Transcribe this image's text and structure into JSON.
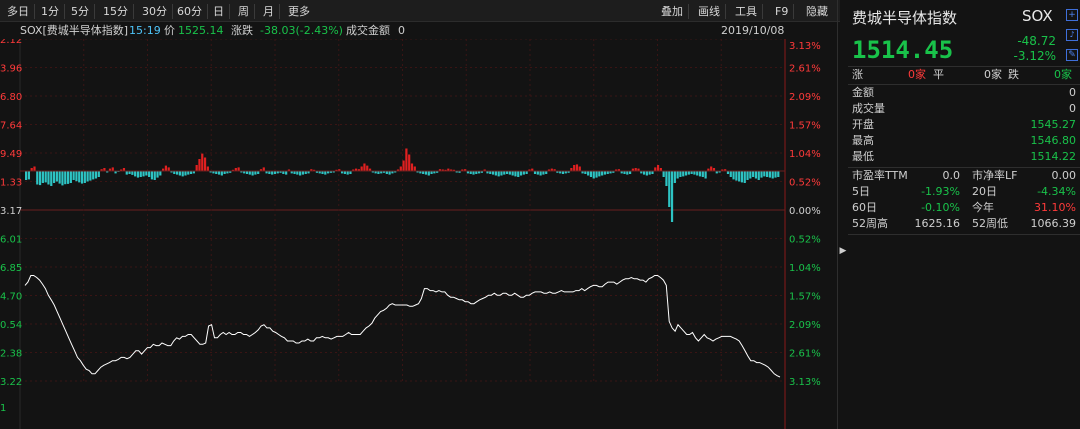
{
  "toolbar": {
    "periods": [
      "多日",
      "1分",
      "5分",
      "15分",
      "30分",
      "60分",
      "日",
      "周",
      "月",
      "更多"
    ],
    "tools": [
      "叠加",
      "画线",
      "工具",
      "F9",
      "隐藏"
    ]
  },
  "infobar": {
    "symbol": "SOX[费城半导体指数]",
    "time": "15:19",
    "price_label": "价",
    "price": "1525.14",
    "change_label": "涨跌",
    "change": "-38.03(-2.43%)",
    "volume_label": "成交金额",
    "volume": "0",
    "date": "2019/10/08"
  },
  "chart_data": {
    "type": "line",
    "title": "SOX[费城半导体指数]",
    "left_ticks": [
      "2.12",
      "3.96",
      "6.80",
      "7.64",
      "9.49",
      "1.33",
      "3.17",
      "6.01",
      "6.85",
      "4.70",
      "0.54",
      "2.38",
      "3.22",
      "1"
    ],
    "right_ticks": [
      "3.13%",
      "2.61%",
      "2.09%",
      "1.57%",
      "1.04%",
      "0.52%",
      "0.00%",
      "0.52%",
      "1.04%",
      "1.57%",
      "2.09%",
      "2.61%",
      "3.13%"
    ],
    "price_series": [
      -1.7,
      -1.65,
      -1.55,
      -1.55,
      -1.58,
      -1.62,
      -1.68,
      -1.75,
      -1.85,
      -1.92,
      -2.0,
      -2.1,
      -2.2,
      -2.3,
      -2.4,
      -2.5,
      -2.6,
      -2.7,
      -2.8,
      -2.85,
      -2.92,
      -2.98,
      -3.0,
      -3.05,
      -3.05,
      -3.0,
      -2.95,
      -2.92,
      -2.9,
      -2.88,
      -2.85,
      -2.85,
      -2.83,
      -2.8,
      -2.8,
      -2.82,
      -2.8,
      -2.75,
      -2.7,
      -2.7,
      -2.75,
      -2.7,
      -2.65,
      -2.65,
      -2.6,
      -2.62,
      -2.62,
      -2.58,
      -2.6,
      -2.62,
      -2.62,
      -2.55,
      -2.5,
      -2.52,
      -2.48,
      -2.48,
      -2.45,
      -2.45,
      -2.5,
      -2.55,
      -2.6,
      -2.6,
      -2.58,
      -2.32,
      -2.3,
      -2.5,
      -2.5,
      -2.45,
      -2.42,
      -2.45,
      -2.42,
      -2.45,
      -2.45,
      -2.42,
      -2.42,
      -2.45,
      -2.45,
      -2.48,
      -2.45,
      -2.42,
      -2.38,
      -2.32,
      -2.3,
      -2.35,
      -2.35,
      -2.4,
      -2.42,
      -2.45,
      -2.48,
      -2.5,
      -2.55,
      -2.55,
      -2.55,
      -2.58,
      -2.58,
      -2.55,
      -2.55,
      -2.52,
      -2.55,
      -2.55,
      -2.5,
      -2.5,
      -2.48,
      -2.5,
      -2.5,
      -2.52,
      -2.5,
      -2.48,
      -2.48,
      -2.48,
      -2.45,
      -2.42,
      -2.45,
      -2.45,
      -2.45,
      -2.45,
      -2.4,
      -2.35,
      -2.32,
      -2.28,
      -2.2,
      -2.15,
      -2.1,
      -2.08,
      -2.05,
      -2.0,
      -1.98,
      -2.0,
      -2.0,
      -2.0,
      -2.0,
      -2.0,
      -2.02,
      -2.02,
      -2.0,
      -1.98,
      -1.9,
      -1.75,
      -1.75,
      -1.78,
      -1.78,
      -1.8,
      -1.78,
      -1.8,
      -1.8,
      -1.85,
      -1.88,
      -1.88,
      -1.9,
      -1.92,
      -1.92,
      -1.95,
      -1.95,
      -1.98,
      -1.98,
      -1.95,
      -1.92,
      -1.9,
      -1.88,
      -1.85,
      -1.85,
      -1.82,
      -1.85,
      -1.85,
      -1.82,
      -1.82,
      -1.85,
      -1.85,
      -1.82,
      -1.85,
      -1.88,
      -1.88,
      -1.85,
      -1.85,
      -1.82,
      -1.8,
      -1.8,
      -1.8,
      -1.82,
      -1.82,
      -1.8,
      -1.82,
      -1.82,
      -1.8,
      -1.78,
      -1.8,
      -1.8,
      -1.8,
      -1.8,
      -1.78,
      -1.78,
      -1.75,
      -1.78,
      -1.75,
      -1.72,
      -1.7,
      -1.7,
      -1.72,
      -1.72,
      -1.68,
      -1.65,
      -1.65,
      -1.65,
      -1.68,
      -1.65,
      -1.62,
      -1.6,
      -1.6,
      -1.58,
      -1.6,
      -1.6,
      -1.62,
      -1.62,
      -1.65,
      -1.6,
      -1.58,
      -1.55,
      -1.55,
      -1.58,
      -1.62,
      -1.7,
      -2.25,
      -2.35,
      -2.4,
      -2.3,
      -2.35,
      -2.4,
      -2.45,
      -2.45,
      -2.42,
      -2.5,
      -2.55,
      -2.5,
      -2.45,
      -2.5,
      -2.52,
      -2.55,
      -2.52,
      -2.5,
      -2.48,
      -2.48,
      -2.48,
      -2.48,
      -2.5,
      -2.52,
      -2.55,
      -2.62,
      -2.7,
      -2.78,
      -2.85,
      -2.85,
      -2.88,
      -2.88,
      -2.9,
      -2.92,
      -2.95,
      -3.0,
      -3.05,
      -3.08,
      -3.1
    ],
    "volume_series": [
      -0.3,
      -0.28,
      0.1,
      0.15,
      -0.45,
      -0.47,
      -0.4,
      -0.38,
      -0.45,
      -0.5,
      -0.4,
      -0.35,
      -0.42,
      -0.48,
      -0.44,
      -0.43,
      -0.4,
      -0.3,
      -0.34,
      -0.38,
      -0.42,
      -0.4,
      -0.35,
      -0.32,
      -0.28,
      -0.25,
      -0.2,
      0.06,
      0.1,
      -0.05,
      0.08,
      0.12,
      -0.08,
      -0.03,
      0.05,
      0.1,
      -0.12,
      -0.1,
      -0.13,
      -0.18,
      -0.22,
      -0.2,
      -0.18,
      -0.15,
      -0.2,
      -0.28,
      -0.3,
      -0.22,
      -0.15,
      0.08,
      0.18,
      0.12,
      -0.05,
      -0.1,
      -0.12,
      -0.15,
      -0.18,
      -0.15,
      -0.12,
      -0.1,
      -0.08,
      0.2,
      0.4,
      0.58,
      0.45,
      0.15,
      -0.05,
      -0.08,
      -0.1,
      -0.12,
      -0.15,
      -0.1,
      -0.08,
      -0.06,
      0.04,
      0.1,
      0.12,
      -0.05,
      -0.08,
      -0.1,
      -0.12,
      -0.15,
      -0.12,
      -0.1,
      0.06,
      0.12,
      -0.08,
      -0.1,
      -0.12,
      -0.1,
      -0.08,
      -0.06,
      -0.1,
      -0.12,
      0.05,
      -0.08,
      -0.1,
      -0.12,
      -0.15,
      -0.12,
      -0.1,
      -0.08,
      0.06,
      0.04,
      -0.06,
      -0.08,
      -0.1,
      -0.12,
      -0.08,
      -0.06,
      -0.05,
      0.04,
      0.06,
      -0.08,
      -0.1,
      -0.12,
      -0.1,
      0.05,
      0.08,
      0.06,
      0.15,
      0.25,
      0.18,
      0.08,
      -0.05,
      -0.08,
      -0.1,
      -0.08,
      -0.06,
      -0.1,
      -0.12,
      -0.08,
      -0.05,
      0.05,
      0.15,
      0.35,
      0.75,
      0.55,
      0.25,
      0.15,
      -0.05,
      -0.08,
      -0.1,
      -0.12,
      -0.15,
      -0.1,
      -0.08,
      -0.06,
      0.06,
      0.05,
      0.04,
      0.08,
      0.05,
      0.04,
      -0.05,
      -0.06,
      0.05,
      0.06,
      -0.08,
      -0.1,
      -0.12,
      -0.1,
      -0.08,
      -0.06,
      0.05,
      -0.08,
      -0.1,
      -0.12,
      -0.15,
      -0.18,
      -0.15,
      -0.12,
      -0.1,
      -0.12,
      -0.15,
      -0.18,
      -0.2,
      -0.15,
      -0.12,
      -0.1,
      0.05,
      0.08,
      -0.1,
      -0.12,
      -0.15,
      -0.12,
      -0.1,
      0.05,
      0.08,
      0.06,
      -0.06,
      -0.08,
      -0.1,
      -0.08,
      -0.06,
      0.1,
      0.2,
      0.22,
      0.15,
      -0.08,
      -0.1,
      -0.15,
      -0.2,
      -0.25,
      -0.22,
      -0.18,
      -0.15,
      -0.12,
      -0.1,
      -0.08,
      -0.06,
      0.05,
      0.06,
      -0.08,
      -0.1,
      -0.12,
      -0.1,
      0.08,
      0.1,
      0.08,
      -0.08,
      -0.12,
      -0.15,
      -0.12,
      -0.1,
      0.12,
      0.2,
      0.1,
      -0.2,
      -0.5,
      -1.2,
      -1.7,
      -0.4,
      -0.25,
      -0.2,
      -0.18,
      -0.15,
      -0.12,
      -0.1,
      -0.12,
      -0.15,
      -0.18,
      -0.2,
      -0.25,
      0.08,
      0.15,
      0.1,
      -0.08,
      -0.05,
      0.05,
      0.06,
      -0.1,
      -0.2,
      -0.28,
      -0.32,
      -0.35,
      -0.38,
      -0.4,
      -0.3,
      -0.25,
      -0.2,
      -0.25,
      -0.3,
      -0.22,
      -0.18,
      -0.2,
      -0.22,
      -0.25,
      -0.22,
      -0.2
    ],
    "ylim": [
      -3.13,
      3.13
    ],
    "baseline_pct": 0.0
  },
  "panel": {
    "name": "费城半导体指数",
    "code": "SOX",
    "price": "1514.45",
    "change": "-48.72",
    "change_pct": "-3.12%",
    "breadth": {
      "up_label": "涨",
      "up_count": "0家",
      "flat_label": "平",
      "flat_count": "0家",
      "down_label": "跌",
      "down_count": "0家"
    },
    "stats": [
      {
        "label": "金额",
        "value": "0"
      },
      {
        "label": "成交量",
        "value": "0"
      },
      {
        "label": "开盘",
        "value": "1545.27"
      },
      {
        "label": "最高",
        "value": "1546.80"
      },
      {
        "label": "最低",
        "value": "1514.22"
      }
    ],
    "ratios": [
      {
        "l1": "市盈率TTM",
        "v1": "0.0",
        "l2": "市净率LF",
        "v2": "0.00"
      },
      {
        "l1": "5日",
        "v1": "-1.93%",
        "l2": "20日",
        "v2": "-4.34%"
      },
      {
        "l1": "60日",
        "v1": "-0.10%",
        "l2": "今年",
        "v2": "31.10%"
      },
      {
        "l1": "52周高",
        "v1": "1625.16",
        "l2": "52周低",
        "v2": "1066.39"
      }
    ],
    "colors": {
      "up": "#ff3a3a",
      "down": "#19c24a",
      "price": "#19c24a",
      "line": "#ffffff",
      "bar_up": "#e02020",
      "bar_down": "#2ec4c4"
    }
  }
}
